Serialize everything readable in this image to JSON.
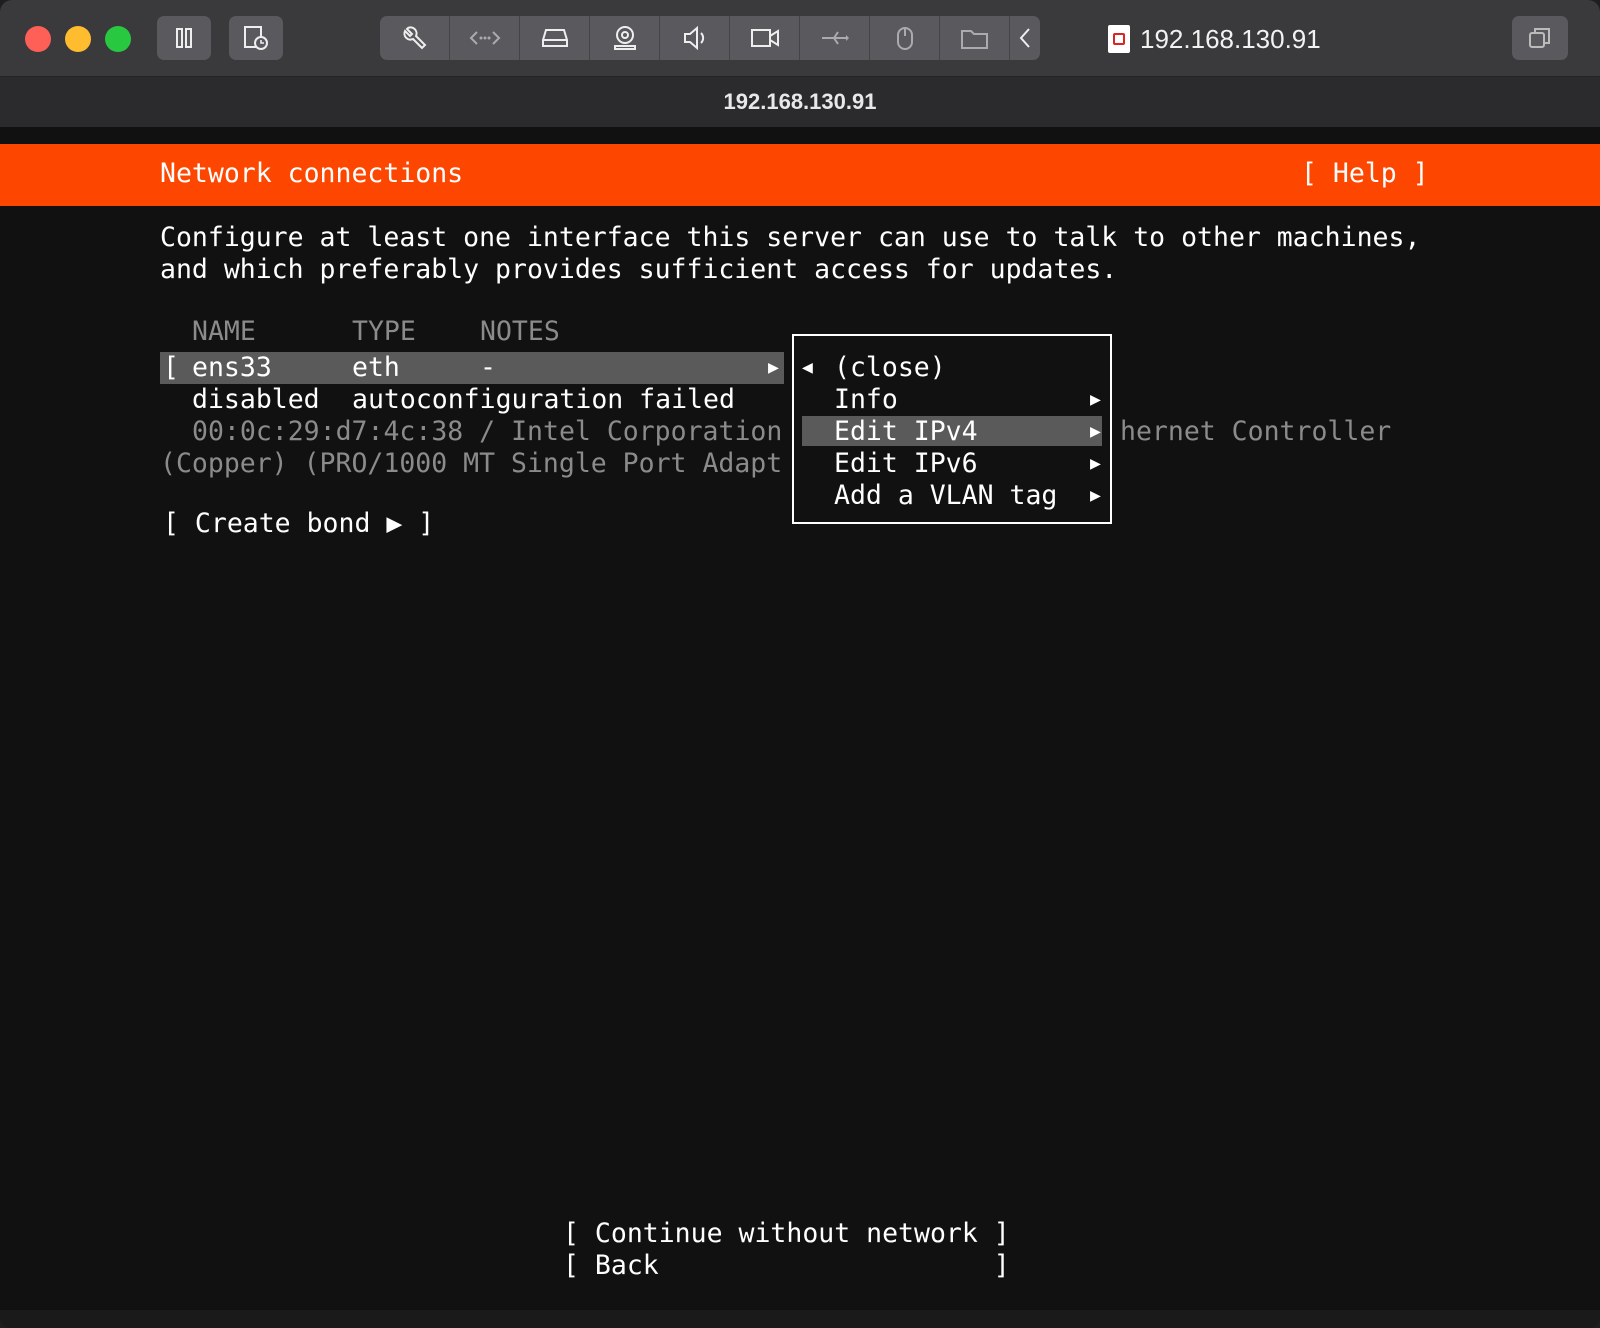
{
  "window": {
    "host_label": "192.168.130.91",
    "title": "192.168.130.91"
  },
  "toolbar": {
    "icons": [
      "pause-icon",
      "snapshot-icon",
      "wrench-icon",
      "network-arrows-icon",
      "hard-disk-icon",
      "camera-icon",
      "sound-icon",
      "video-camera-icon",
      "usb-icon",
      "mouse-icon",
      "folder-share-icon",
      "chevron-left-icon",
      "window-restore-icon"
    ]
  },
  "installer": {
    "header_title": "Network connections",
    "help": "[ Help ]",
    "description_line1": "Configure at least one interface this server can use to talk to other machines,",
    "description_line2": "and which preferably provides sufficient access for updates.",
    "columns": {
      "name": "NAME",
      "type": "TYPE",
      "notes": "NOTES"
    },
    "interface": {
      "bracket": "[",
      "name": "ens33",
      "type": "eth",
      "notes": "-",
      "arrow": "▶",
      "status": "disabled",
      "status_detail": "autoconfiguration failed",
      "hw_line1_left": "00:0c:29:d7:4c:38 / Intel Corporation",
      "hw_line1_right": "hernet Controller",
      "hw_line2": "(Copper) (PRO/1000 MT Single Port Adapt"
    },
    "create_bond": "[ Create bond ▶ ]",
    "popup": {
      "close_arrow": "◀",
      "items": [
        {
          "label": "(close)",
          "arrow": ""
        },
        {
          "label": "Info",
          "arrow": "▶"
        },
        {
          "label": "Edit IPv4",
          "arrow": "▶"
        },
        {
          "label": "Edit IPv6",
          "arrow": "▶"
        },
        {
          "label": "Add a VLAN tag",
          "arrow": "▶"
        }
      ]
    },
    "continue_button": "[ Continue without network ]",
    "back_button": "[ Back                     ]"
  },
  "colors": {
    "header": "#fd4700",
    "highlight": "#5a5a5a"
  }
}
